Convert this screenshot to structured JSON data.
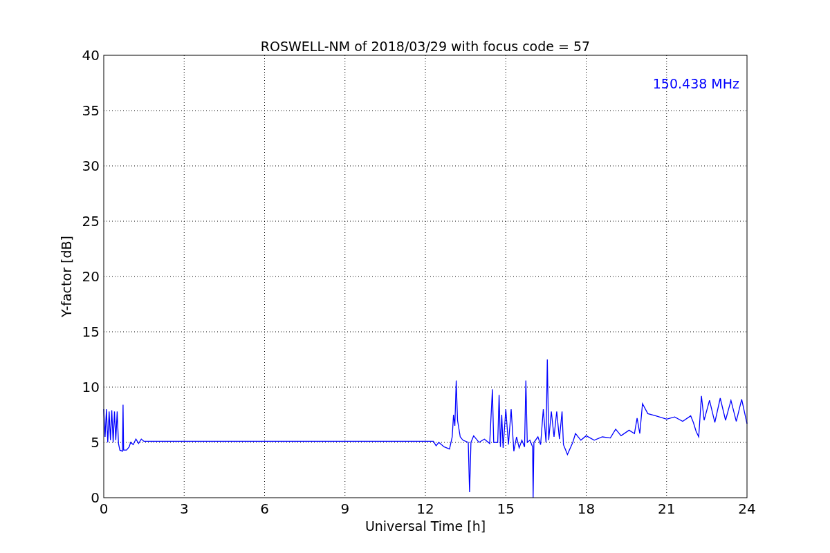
{
  "chart_data": {
    "type": "line",
    "title": "ROSWELL-NM of 2018/03/29 with focus code = 57",
    "xlabel": "Universal Time [h]",
    "ylabel": "Y-factor [dB]",
    "xlim": [
      0,
      24
    ],
    "ylim": [
      0,
      40
    ],
    "xticks": [
      0,
      3,
      6,
      9,
      12,
      15,
      18,
      21,
      24
    ],
    "yticks": [
      0,
      5,
      10,
      15,
      20,
      25,
      30,
      35,
      40
    ],
    "x": [
      0,
      0.05,
      0.1,
      0.15,
      0.2,
      0.25,
      0.3,
      0.35,
      0.4,
      0.45,
      0.5,
      0.55,
      0.6,
      0.7,
      0.72,
      0.74,
      0.85,
      0.95,
      1.0,
      1.1,
      1.2,
      1.3,
      1.4,
      1.5,
      12.3,
      12.4,
      12.5,
      12.7,
      12.9,
      13.0,
      13.05,
      13.1,
      13.15,
      13.2,
      13.3,
      13.4,
      13.6,
      13.65,
      13.7,
      13.8,
      14.0,
      14.2,
      14.4,
      14.5,
      14.55,
      14.7,
      14.75,
      14.8,
      14.85,
      14.9,
      15.0,
      15.1,
      15.2,
      15.3,
      15.4,
      15.5,
      15.6,
      15.7,
      15.75,
      15.8,
      15.9,
      16.0,
      16.02,
      16.05,
      16.2,
      16.3,
      16.4,
      16.5,
      16.55,
      16.6,
      16.7,
      16.8,
      16.9,
      17.0,
      17.1,
      17.15,
      17.3,
      17.5,
      17.6,
      17.8,
      18.0,
      18.3,
      18.6,
      18.9,
      19.1,
      19.3,
      19.6,
      19.8,
      19.9,
      20.0,
      20.1,
      20.3,
      20.6,
      21.0,
      21.3,
      21.6,
      21.9,
      22.0,
      22.1,
      22.2,
      22.3,
      22.4,
      22.6,
      22.8,
      23.0,
      23.2,
      23.4,
      23.6,
      23.8,
      24.0
    ],
    "series": [
      {
        "color": "#0000ff",
        "values": [
          8,
          5.5,
          8,
          5,
          7.8,
          5.2,
          7.9,
          5,
          7.8,
          5.2,
          7.8,
          4.9,
          4.3,
          4.2,
          8.4,
          4.3,
          4.3,
          4.6,
          5.0,
          4.8,
          5.3,
          4.9,
          5.3,
          5.1,
          5.1,
          4.7,
          5.0,
          4.6,
          4.4,
          5.5,
          7.5,
          6.5,
          10.6,
          7.0,
          5.5,
          5.2,
          5.0,
          0.5,
          5.0,
          5.6,
          5.0,
          5.3,
          4.9,
          9.8,
          5.0,
          5.0,
          9.3,
          4.6,
          7.5,
          4.5,
          8,
          4.8,
          8,
          4.2,
          5.5,
          4.5,
          5.2,
          4.6,
          10.6,
          5,
          5.2,
          4.6,
          0,
          5,
          5.5,
          4.8,
          8,
          5,
          12.5,
          5.2,
          7.8,
          5.5,
          7.8,
          5.3,
          7.8,
          4.8,
          3.9,
          5,
          5.8,
          5.2,
          5.6,
          5.2,
          5.5,
          5.4,
          6.2,
          5.6,
          6.1,
          5.8,
          7.2,
          5.8,
          8.5,
          7.6,
          7.4,
          7.1,
          7.3,
          6.9,
          7.4,
          6.8,
          6.0,
          5.5,
          9.2,
          7.0,
          8.8,
          6.8,
          9.0,
          7.0,
          8.8,
          6.9,
          8.9,
          6.7
        ]
      }
    ],
    "grid": true,
    "annotations": [
      {
        "text": "150.438 MHz"
      }
    ]
  }
}
